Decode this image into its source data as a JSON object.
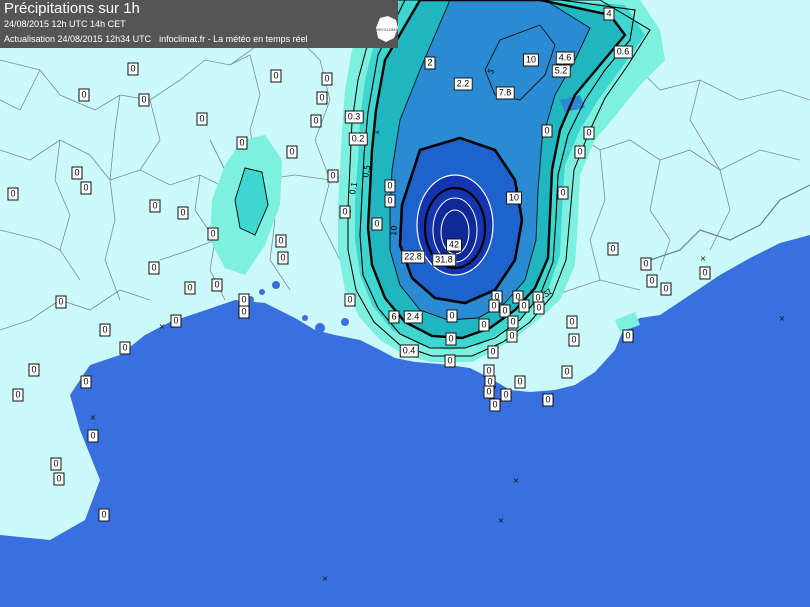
{
  "header": {
    "title": "Précipitations sur 1h",
    "run_info": "24/08/2015  12h UTC  14h CET",
    "update_info": "Actualisation 24/08/2015 12h34 UTC",
    "site": "infoclimat.fr - La météo en temps réel",
    "logo_text": "INFOCLIMAT"
  },
  "colors": {
    "land": "#ccfafa",
    "sea": "#3a6fe0",
    "light_cyan": "#7ef0e0",
    "cyan": "#3ed7cf",
    "teal": "#1fb6bf",
    "light_blue": "#2a8ad2",
    "blue": "#1e62cd",
    "dark_blue": "#1434b0",
    "header_bg": "#555555",
    "border_lines": "#7a8d98"
  },
  "contour_labels": [
    "1",
    "1",
    "0.5",
    "0.1",
    "10",
    "5",
    "0.5",
    "1"
  ],
  "station_values": {
    "s1": "0",
    "s2": "0",
    "s3": "0",
    "s4": "0",
    "s5": "0",
    "s6": "0",
    "s7": "2",
    "s8": "0",
    "s9": "0",
    "s10": "10",
    "s11": "4.6",
    "s12": "5.2",
    "s13": "4",
    "s14": "0.6",
    "s15": "2.2",
    "s16": "7.8",
    "s17": "0.3",
    "s18": "0.2",
    "s19": "0",
    "s20": "0",
    "s21": "0",
    "s22": "0",
    "s23": "0",
    "s24": "0",
    "s25": "0",
    "s26": "0",
    "s27": "0",
    "s28": "0",
    "s29": "0",
    "s30": "0",
    "s31": "0",
    "s32": "0",
    "s33": "10",
    "s34": "0",
    "s35": "42",
    "s36": "22.8",
    "s37": "31.8",
    "s38": "0",
    "s39": "0",
    "s40": "0",
    "s41": "0",
    "s42": "0",
    "s43": "0",
    "s44": "0",
    "s45": "0",
    "s46": "0",
    "s47": "0",
    "s48": "0",
    "s49": "0",
    "s50": "0",
    "s51": "0",
    "s52": "0",
    "s53": "0",
    "s54": "0",
    "s55": "0",
    "s56": "0",
    "s57": "0",
    "s58": "0",
    "s59": "0",
    "s60": "0",
    "s61": "0",
    "s62": "0",
    "s63": "6",
    "s64": "2.4",
    "s65": "0",
    "s66": "0",
    "s67": "0",
    "s68": "0.4",
    "s69": "0",
    "s70": "0",
    "s71": "0",
    "s72": "0",
    "s73": "0",
    "s74": "0",
    "s75": "0",
    "s76": "0",
    "s77": "0",
    "s78": "0",
    "s79": "0",
    "s80": "0",
    "s81": "0",
    "s82": "0",
    "s83": "0",
    "s84": "0",
    "s85": "0",
    "s86": "0",
    "s87": "0",
    "s88": "0",
    "s89": "0",
    "s90": "0",
    "s91": "0"
  }
}
